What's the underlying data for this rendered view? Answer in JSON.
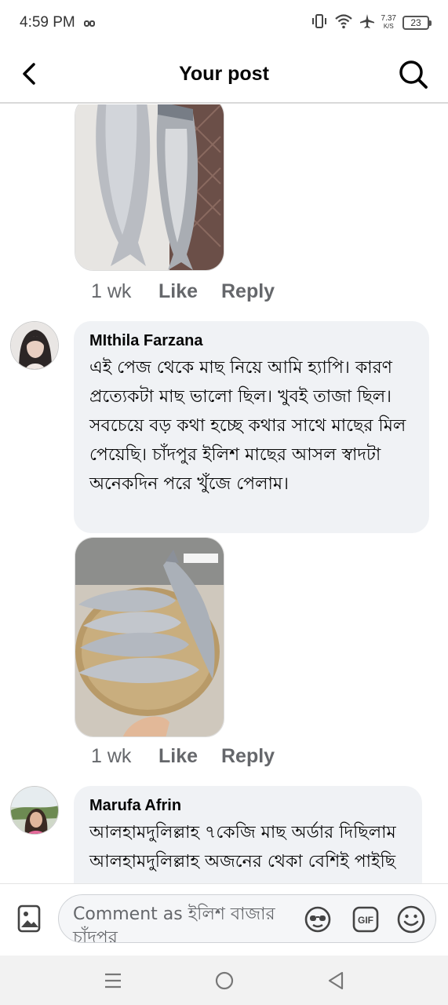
{
  "status_bar": {
    "time": "4:59 PM",
    "net_speed_value": "7.37",
    "net_speed_unit": "K/S",
    "battery": "23",
    "icons": [
      "infinity-icon",
      "vibrate-icon",
      "wifi-icon",
      "airplane-icon",
      "battery-icon"
    ]
  },
  "header": {
    "title": "Your post",
    "back_icon": "back-arrow-icon",
    "search_icon": "search-icon"
  },
  "comments": [
    {
      "photo": "fish-photo",
      "time": "1 wk",
      "like_label": "Like",
      "reply_label": "Reply"
    },
    {
      "author": "MIthila Farzana",
      "text": "এই পেজ থেকে মাছ নিয়ে আমি হ্যাপি। কারণ প্রত্যেকটা মাছ ভালো ছিল। খুবই তাজা ছিল। সবচেয়ে বড় কথা হচ্ছে কথার সাথে মাছের মিল পেয়েছি। চাঁদপুর ইলিশ মাছের আসল স্বাদটা অনেকদিন পরে খুঁজে পেলাম।",
      "photo": "fish-basket-photo",
      "time": "1 wk",
      "like_label": "Like",
      "reply_label": "Reply"
    },
    {
      "author": "Marufa Afrin",
      "text": "আলহামদুলিল্লাহ ৭কেজি মাছ অর্ডার দিছিলাম আলহামদুলিল্লাহ অজনের থেকা বেশিই পাইছি মাছগুলো অনেক তাজা"
    }
  ],
  "composer": {
    "placeholder": "Comment as ইলিশ বাজার চাঁদপুর",
    "icons": [
      "photo-icon",
      "sticker-icon",
      "gif-icon",
      "emoji-icon"
    ]
  },
  "nav_bar": {
    "icons": [
      "recents-icon",
      "home-icon",
      "back-icon"
    ]
  }
}
